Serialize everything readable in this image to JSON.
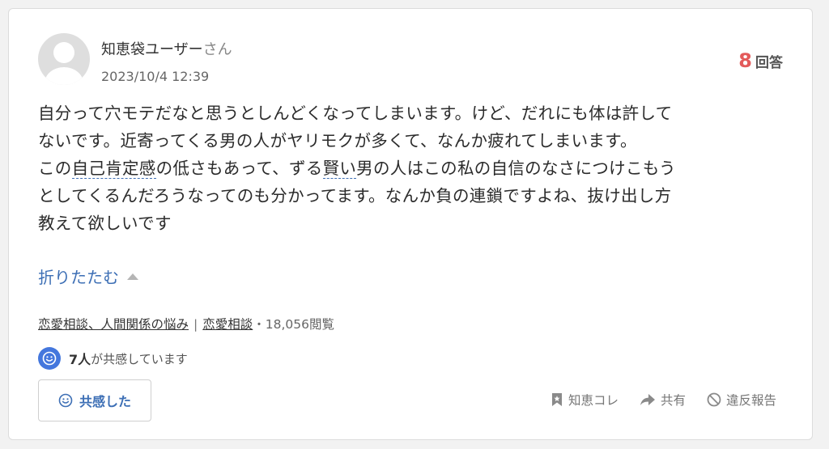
{
  "user": {
    "name": "知恵袋ユーザー",
    "honorific": "さん",
    "posted_at": "2023/10/4 12:39"
  },
  "answers": {
    "count": "8",
    "label": "回答"
  },
  "question": {
    "line1": "自分って穴モテだなと思うとしんどくなってしまいます。けど、だれにも体は許して",
    "line2": "ないです。近寄ってくる男の人がヤリモクが多くて、なんか疲れてしまいます。",
    "line3_a": "この",
    "line3_term1": "自己肯定感",
    "line3_b": "の低さもあって、ずる",
    "line3_term2": "賢い",
    "line3_c": "男の人はこの私の自信のなさにつけこもう",
    "line4": "としてくるんだろうなってのも分かってます。なんか負の連鎖ですよね、抜け出し方",
    "line5": "教えて欲しいです"
  },
  "collapse_label": "折りたたむ",
  "categories": {
    "cat1": "恋愛相談、人間関係の悩み",
    "separator": "|",
    "cat2": "恋愛相談",
    "views": "・18,056閲覧"
  },
  "empathy": {
    "count": "7人",
    "suffix": "が共感しています",
    "button_label": "共感した"
  },
  "actions": {
    "bookmark": "知恵コレ",
    "share": "共有",
    "report": "違反報告"
  },
  "colors": {
    "accent_blue": "#3d6fb5",
    "answer_red": "#e35a5a",
    "badge_blue": "#4477dd"
  }
}
